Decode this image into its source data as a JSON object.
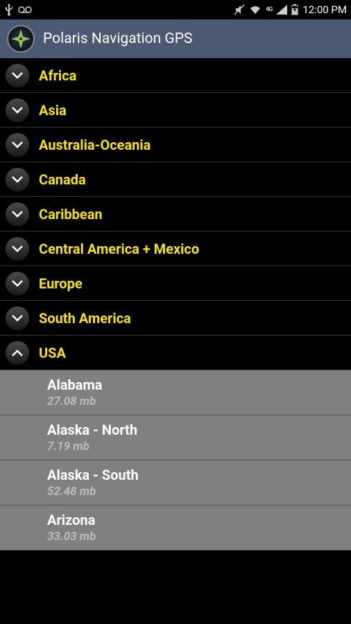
{
  "status_bar": {
    "time": "12:00 PM",
    "network_label": "4G"
  },
  "header": {
    "title": "Polaris Navigation GPS"
  },
  "regions": [
    {
      "label": "Africa",
      "expanded": false
    },
    {
      "label": "Asia",
      "expanded": false
    },
    {
      "label": "Australia-Oceania",
      "expanded": false
    },
    {
      "label": "Canada",
      "expanded": false
    },
    {
      "label": "Caribbean",
      "expanded": false
    },
    {
      "label": "Central America + Mexico",
      "expanded": false
    },
    {
      "label": "Europe",
      "expanded": false
    },
    {
      "label": "South America",
      "expanded": false
    },
    {
      "label": "USA",
      "expanded": true
    }
  ],
  "usa_items": [
    {
      "name": "Alabama",
      "size": "27.08 mb"
    },
    {
      "name": "Alaska - North",
      "size": "7.19 mb"
    },
    {
      "name": "Alaska - South",
      "size": "52.48 mb"
    },
    {
      "name": "Arizona",
      "size": "33.03 mb"
    }
  ]
}
